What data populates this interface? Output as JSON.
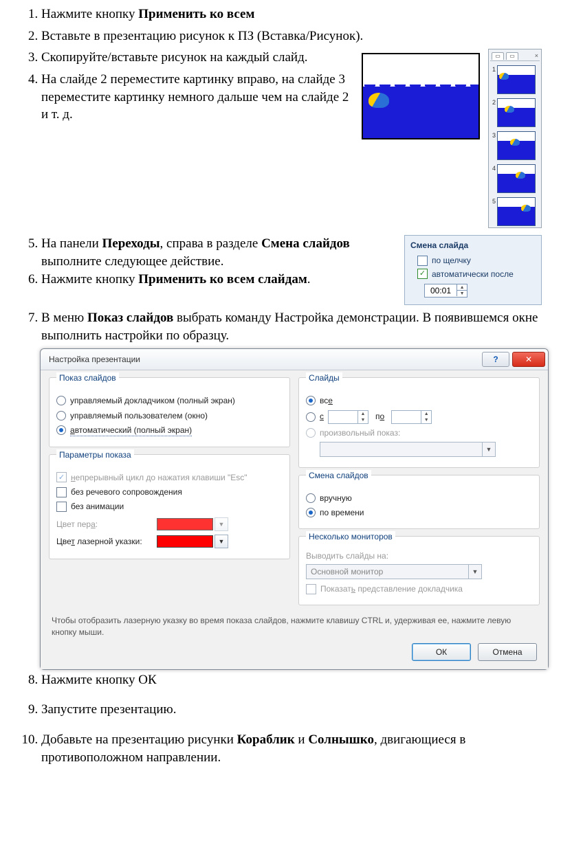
{
  "list": {
    "i1_pre": "Нажмите кнопку ",
    "i1_b": "Применить ко всем",
    "i2": "Вставьте в презентацию рисунок к ПЗ (Вставка/Рисунок).",
    "i3": "Скопируйте/вставьте рисунок на каждый слайд.",
    "i4": "На слайде 2  переместите картинку вправо, на слайде 3 переместите картинку немного дальше чем на слайде 2 и т. д.",
    "i5_a": "На панели ",
    "i5_b": "Переходы",
    "i5_c": ", справа в разделе ",
    "i5_d": "Смена слайдов",
    "i5_e": " выполните следующее действие.",
    "i6_a": "Нажмите кнопку ",
    "i6_b": "Применить ко всем слайдам",
    "i6_c": ".",
    "i7_a": "В меню ",
    "i7_b": "Показ слайдов",
    "i7_c": " выбрать команду Настройка демонстрации. В появившемся окне выполнить настройки по образцу.",
    "i8": "Нажмите  кнопку ОК",
    "i9": "Запустите презентацию.",
    "i10_a": "Добавьте на презентацию рисунки ",
    "i10_b": "Кораблик",
    "i10_c": " и ",
    "i10_d": "Солнышко",
    "i10_e": ", двигающиеся в противоположном направлении."
  },
  "thumbs": {
    "n1": "1",
    "n2": "2",
    "n3": "3",
    "n4": "4",
    "n5": "5",
    "close": "×",
    "tab_icon": "▭"
  },
  "advance": {
    "header": "Смена слайда",
    "on_click": "по щелчку",
    "auto_after": "автоматически после",
    "time_value": "00:01"
  },
  "dialog": {
    "title": "Настройка презентации",
    "help": "?",
    "close": "✕",
    "group_show": "Показ слайдов",
    "opt_presenter": "управляемый докладчиком (полный экран)",
    "opt_user": "управляемый пользователем (окно)",
    "opt_auto_pre_u": "а",
    "opt_auto_rest": "втоматический (полный экран)",
    "group_slides": "Слайды",
    "slides_all_pre_u": "вс",
    "slides_all_u": "е",
    "slides_from_u": "с",
    "slides_to_pre": "п",
    "slides_to_u": "о",
    "slides_custom": "произвольный показ:",
    "group_params": "Параметры показа",
    "param_loop_pre_u": "н",
    "param_loop_rest": "епрерывный цикл до нажатия клавиши \"Esc\"",
    "param_no_narration": "без речевого сопровождения",
    "param_no_anim": "без анимации",
    "pen_color_pre": "Цвет пер",
    "pen_color_u": "а",
    "pen_color_post": ":",
    "laser_color_pre": "Цве",
    "laser_color_u": "т",
    "laser_color_post": " лазерной указки:",
    "group_advance": "Смена слайдов",
    "adv_manual": "вручную",
    "adv_timing": "по времени",
    "group_monitors": "Несколько мониторов",
    "mon_label": "Выводить слайды на:",
    "mon_value": "Основной монитор",
    "mon_presenter_pre": "Показат",
    "mon_presenter_u": "ь",
    "mon_presenter_post": " представление докладчика",
    "hint": "Чтобы отобразить лазерную указку во время показа слайдов, нажмите клавишу CTRL и, удерживая ее, нажмите левую кнопку мыши.",
    "ok": "ОК",
    "cancel": "Отмена"
  }
}
